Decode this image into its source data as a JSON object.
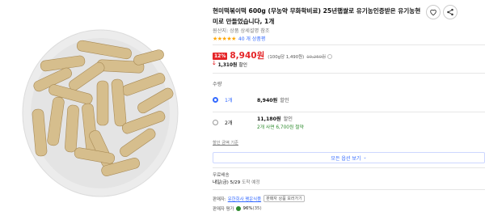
{
  "product": {
    "title": "현미떡볶이떡 600g (무농약 무화학비료) 25년햅쌀로 유기농인증받은 유기농현미로 만들었습니다, 1개",
    "origin": "원산지: 상품 상세설명 참조",
    "rating_stars": "★★★★★",
    "review_count": "40 개 상품평"
  },
  "price": {
    "discount_badge": "12%",
    "sale_price": "8,940원",
    "unit_price": "(100g당 1,490원)",
    "original_price": "10,250원",
    "coupon_arrow": "🡓",
    "coupon_amount": "1,310원",
    "coupon_label": "할인"
  },
  "quantity": {
    "label": "수량",
    "options": [
      {
        "name": "1개",
        "price": "8,940원",
        "discount": "할인",
        "save": "",
        "selected": true
      },
      {
        "name": "2개",
        "price": "11,180원",
        "discount": "할인",
        "save": "2개 사면 6,700원 절약",
        "selected": false
      }
    ]
  },
  "links": {
    "price_criteria": "할인 금액 기준",
    "all_options": "모든 옵션 보기",
    "all_options_chevron": "⌄"
  },
  "shipping": {
    "label": "무료배송",
    "date": "내일(금) 5/29",
    "date_note": "도착 예정"
  },
  "seller": {
    "label": "판매자:",
    "name": "유한회사 팽운식품",
    "other_products": "판매자 상품 보러가기",
    "rating_label": "판매자 평가",
    "rating_value": "96%",
    "rating_count": "(35)"
  },
  "colors": {
    "accent_red": "#e52528",
    "link_blue": "#346aff",
    "green": "#2e8b2e",
    "star": "#ffa600"
  },
  "icons": {
    "like": "heart-icon",
    "share": "share-icon"
  }
}
